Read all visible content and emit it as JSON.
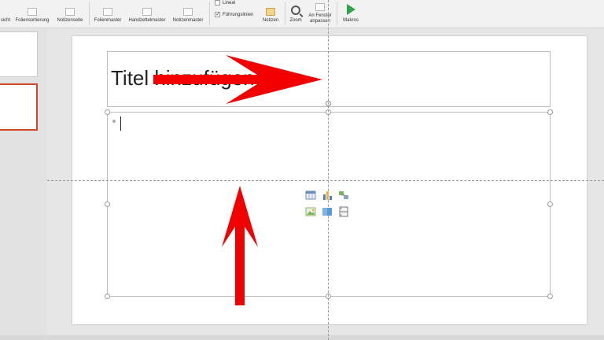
{
  "ribbon": {
    "view_buttons": [
      {
        "label": "sicht",
        "icon": "normal-view-icon"
      },
      {
        "label": "Foliensortierung",
        "icon": "slide-sorter-icon"
      },
      {
        "label": "Notizenseite",
        "icon": "notes-page-icon"
      }
    ],
    "master_buttons": [
      {
        "label": "Folienmaster",
        "icon": "slide-master-icon"
      },
      {
        "label": "Handzettelmaster",
        "icon": "handout-master-icon"
      },
      {
        "label": "Notizenmaster",
        "icon": "notes-master-icon"
      }
    ],
    "checkboxes": [
      {
        "label": "Lineal",
        "checked": false
      },
      {
        "label": "Führungslinien",
        "checked": true
      }
    ],
    "notes_label": "Notizen",
    "zoom_label": "Zoom",
    "fit_window_label_1": "An Fenster",
    "fit_window_label_2": "anpassen",
    "macros_label": "Makros"
  },
  "slide": {
    "title_text": "Titel hinzufügen"
  },
  "insert_icons": [
    "insert-table-icon",
    "insert-chart-icon",
    "insert-smartart-icon",
    "insert-picture-icon",
    "insert-online-picture-icon",
    "insert-video-icon"
  ],
  "colors": {
    "annotation_arrow": "#f20000",
    "selected_thumbnail_border": "#d24726",
    "macro_play": "#2fa34a"
  }
}
